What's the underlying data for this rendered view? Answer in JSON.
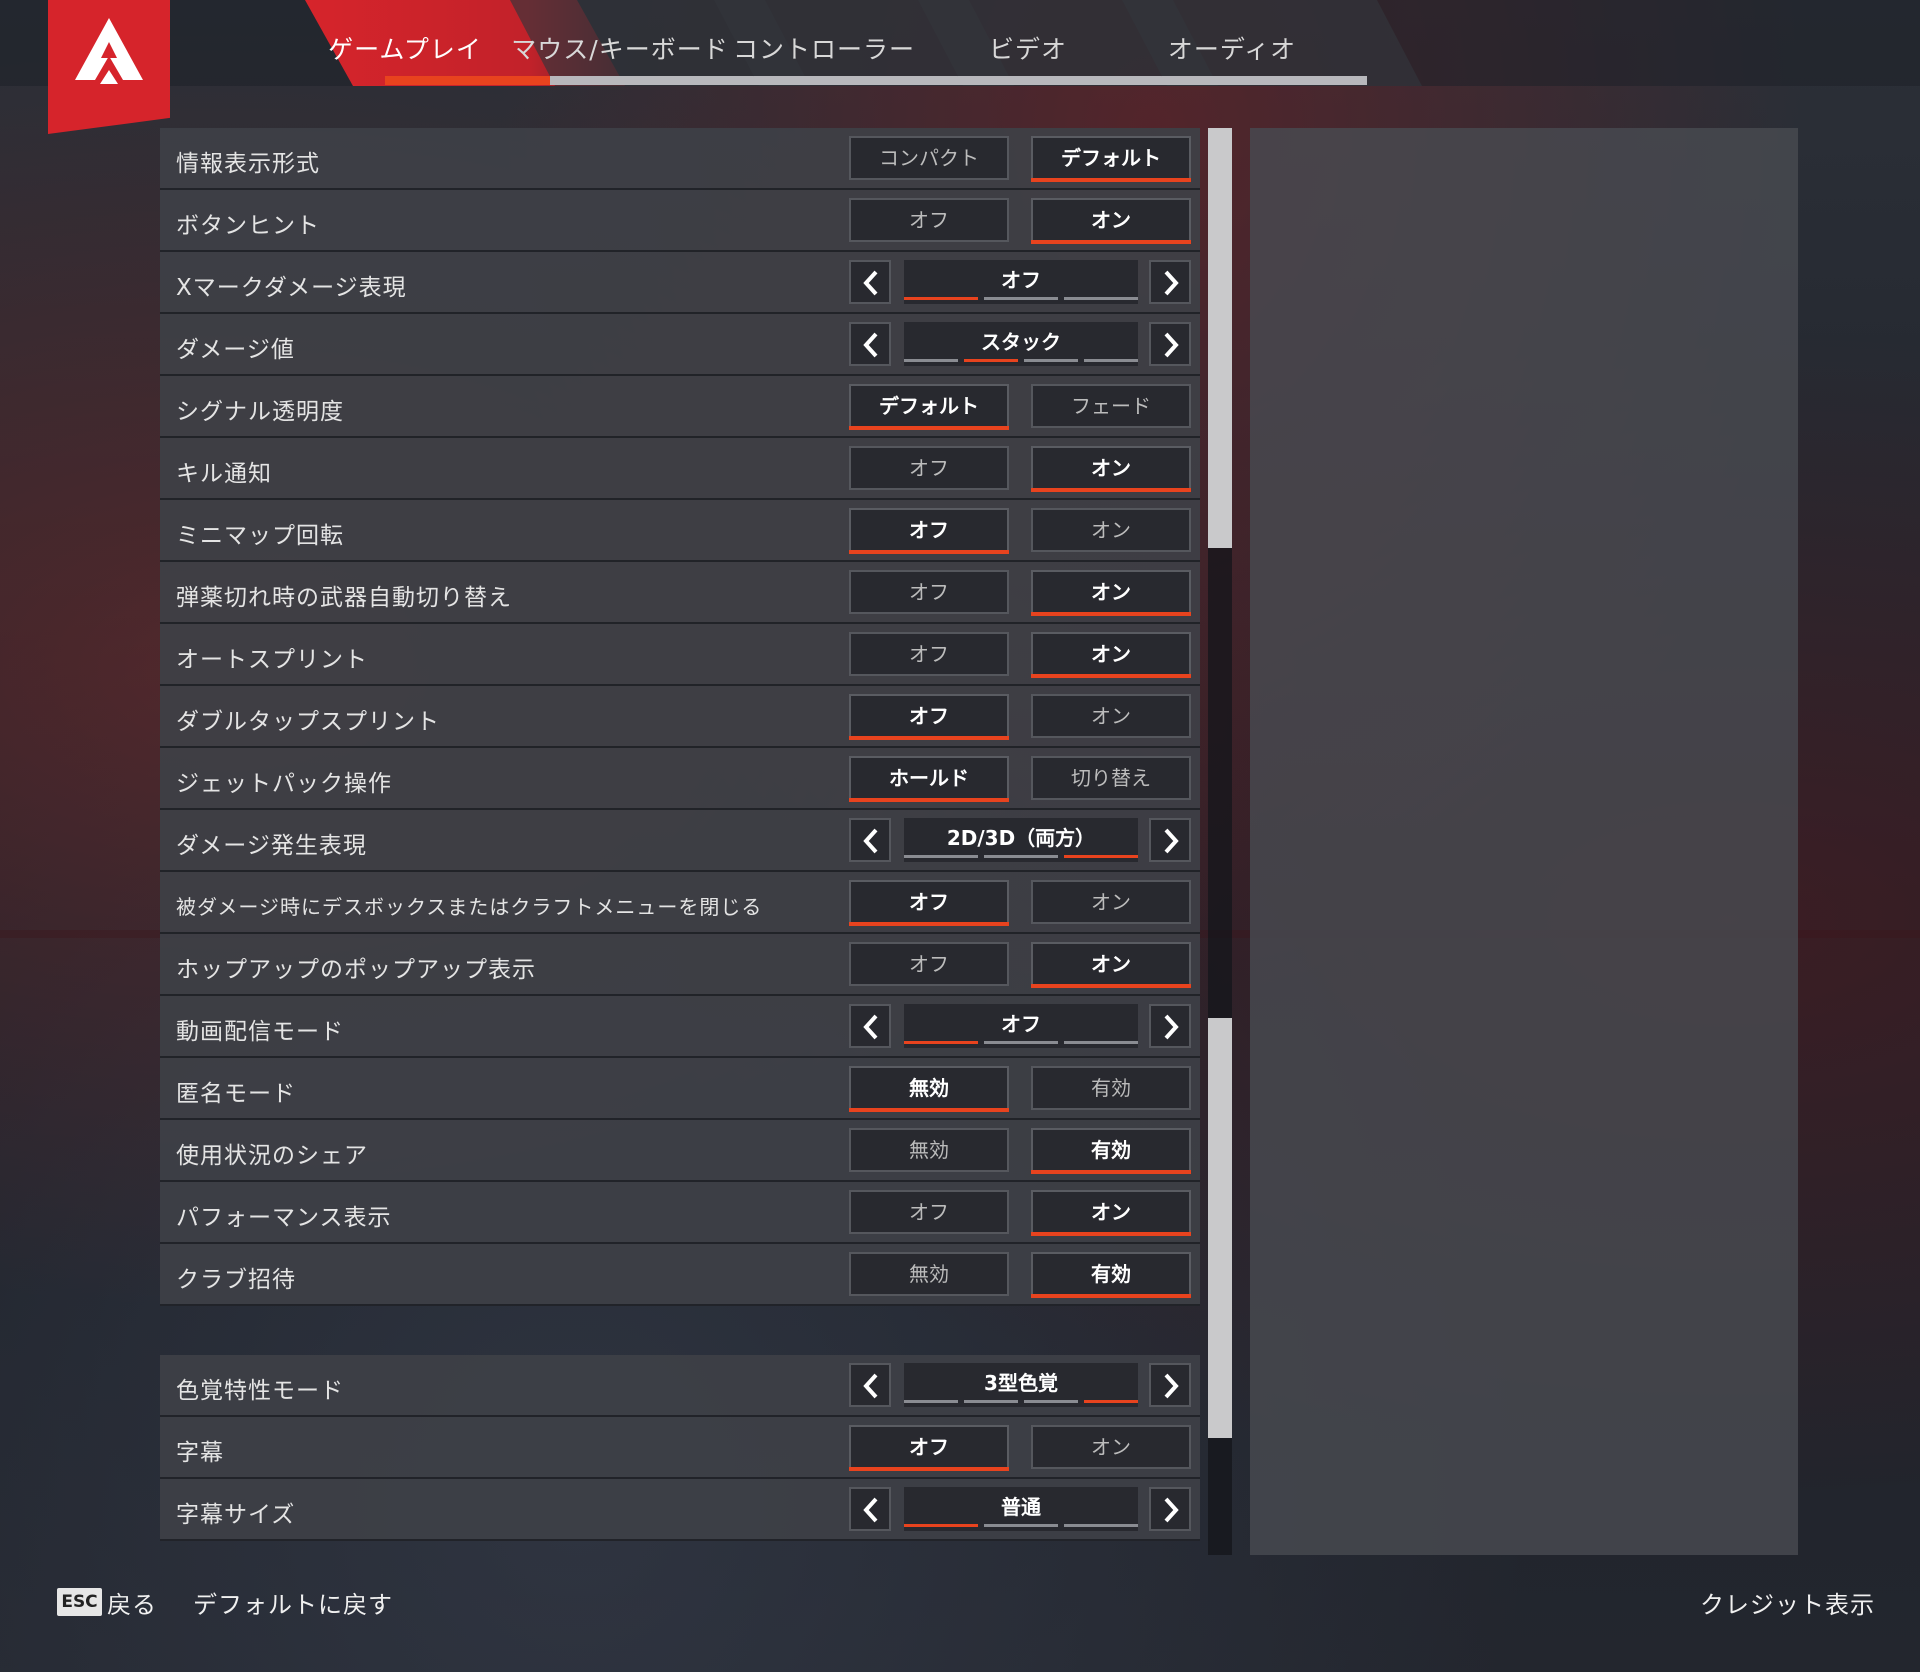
{
  "tabs": [
    {
      "label": "ゲームプレイ",
      "active": true
    },
    {
      "label": "マウス/キーボード",
      "active": false
    },
    {
      "label": "コントローラー",
      "active": false
    },
    {
      "label": "ビデオ",
      "active": false
    },
    {
      "label": "オーディオ",
      "active": false
    }
  ],
  "settings_main": [
    {
      "label": "情報表示形式",
      "type": "toggle",
      "options": [
        "コンパクト",
        "デフォルト"
      ],
      "selected": 1
    },
    {
      "label": "ボタンヒント",
      "type": "toggle",
      "options": [
        "オフ",
        "オン"
      ],
      "selected": 1
    },
    {
      "label": "Xマークダメージ表現",
      "type": "cycle",
      "value": "オフ",
      "segments": 3,
      "current": 0
    },
    {
      "label": "ダメージ値",
      "type": "cycle",
      "value": "スタック",
      "segments": 4,
      "current": 1
    },
    {
      "label": "シグナル透明度",
      "type": "toggle",
      "options": [
        "デフォルト",
        "フェード"
      ],
      "selected": 0
    },
    {
      "label": "キル通知",
      "type": "toggle",
      "options": [
        "オフ",
        "オン"
      ],
      "selected": 1
    },
    {
      "label": "ミニマップ回転",
      "type": "toggle",
      "options": [
        "オフ",
        "オン"
      ],
      "selected": 0
    },
    {
      "label": "弾薬切れ時の武器自動切り替え",
      "type": "toggle",
      "options": [
        "オフ",
        "オン"
      ],
      "selected": 1
    },
    {
      "label": "オートスプリント",
      "type": "toggle",
      "options": [
        "オフ",
        "オン"
      ],
      "selected": 1
    },
    {
      "label": "ダブルタップスプリント",
      "type": "toggle",
      "options": [
        "オフ",
        "オン"
      ],
      "selected": 0
    },
    {
      "label": "ジェットパック操作",
      "type": "toggle",
      "options": [
        "ホールド",
        "切り替え"
      ],
      "selected": 0
    },
    {
      "label": "ダメージ発生表現",
      "type": "cycle",
      "value": "2D/3D（両方）",
      "segments": 3,
      "current": 2
    },
    {
      "label": "被ダメージ時にデスボックスまたはクラフトメニューを閉じる",
      "type": "toggle",
      "options": [
        "オフ",
        "オン"
      ],
      "selected": 0,
      "small": true
    },
    {
      "label": "ホップアップのポップアップ表示",
      "type": "toggle",
      "options": [
        "オフ",
        "オン"
      ],
      "selected": 1
    },
    {
      "label": "動画配信モード",
      "type": "cycle",
      "value": "オフ",
      "segments": 3,
      "current": 0
    },
    {
      "label": "匿名モード",
      "type": "toggle",
      "options": [
        "無効",
        "有効"
      ],
      "selected": 0
    },
    {
      "label": "使用状況のシェア",
      "type": "toggle",
      "options": [
        "無効",
        "有効"
      ],
      "selected": 1
    },
    {
      "label": "パフォーマンス表示",
      "type": "toggle",
      "options": [
        "オフ",
        "オン"
      ],
      "selected": 1
    },
    {
      "label": "クラブ招待",
      "type": "toggle",
      "options": [
        "無効",
        "有効"
      ],
      "selected": 1
    }
  ],
  "settings_access": [
    {
      "label": "色覚特性モード",
      "type": "cycle",
      "value": "3型色覚",
      "segments": 4,
      "current": 3
    },
    {
      "label": "字幕",
      "type": "toggle",
      "options": [
        "オフ",
        "オン"
      ],
      "selected": 0
    },
    {
      "label": "字幕サイズ",
      "type": "cycle",
      "value": "普通",
      "segments": 3,
      "current": 0
    }
  ],
  "scrollbar": {
    "position": 0,
    "visible_fraction": 0.25
  },
  "footer": {
    "esc_key": "ESC",
    "back": "戻る",
    "reset": "デフォルトに戻す",
    "credits": "クレジット表示"
  },
  "colors": {
    "accent": "#e8431e",
    "logo_red": "#d6242b"
  }
}
